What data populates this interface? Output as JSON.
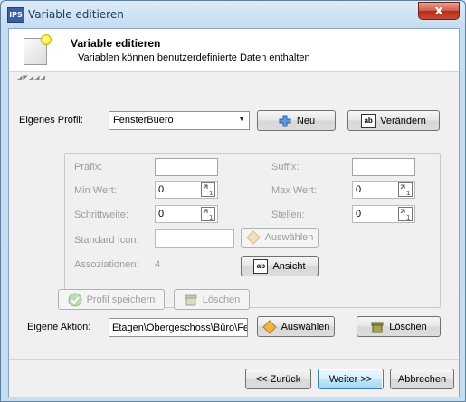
{
  "window": {
    "app_icon": "IPS",
    "title": "Variable editieren",
    "close_glyph": "x"
  },
  "header": {
    "title": "Variable editieren",
    "subtitle": "Variablen können benutzerdefinierte Daten enthalten",
    "icon": "variable-page-icon"
  },
  "profile": {
    "label": "Eigenes Profil:",
    "selected": "FensterBuero",
    "new_label": "Neu",
    "change_label": "Verändern"
  },
  "details": {
    "prefix_label": "Präfix:",
    "prefix_value": "",
    "suffix_label": "Suffix:",
    "suffix_value": "",
    "min_label": "Min Wert:",
    "min_value": "0",
    "max_label": "Max Wert:",
    "max_value": "0",
    "step_label": "Schrittweite:",
    "step_value": "0",
    "digits_label": "Stellen:",
    "digits_value": "0",
    "icon_label": "Standard Icon:",
    "icon_value": "",
    "icon_select_label": "Auswählen",
    "assoc_label": "Assoziationen:",
    "assoc_count": "4",
    "view_label": "Ansicht"
  },
  "profile_actions": {
    "save_label": "Profil speichern",
    "delete_label": "Löschen"
  },
  "action": {
    "label": "Eigene Aktion:",
    "path": "Etagen\\Obergeschoss\\Büro\\Fe",
    "select_label": "Auswählen",
    "delete_label": "Löschen"
  },
  "footer": {
    "back_label": "<< Zurück",
    "next_label": "Weiter >>",
    "cancel_label": "Abbrechen"
  },
  "colors": {
    "title_bar": "#c5dcf1",
    "close_button": "#c94a33",
    "focus_border": "#3c7fb1",
    "disabled_text": "#9d9d9d"
  }
}
